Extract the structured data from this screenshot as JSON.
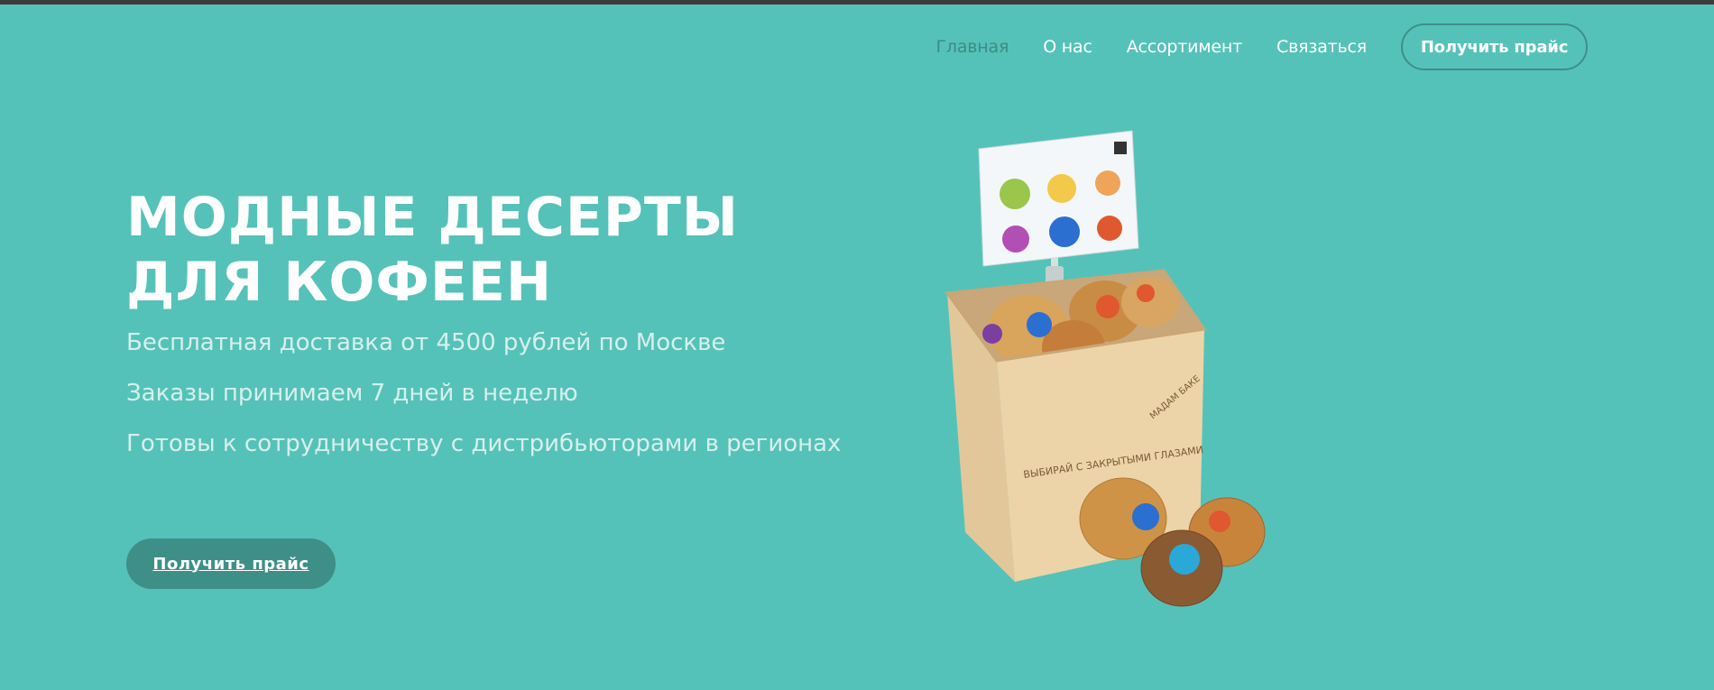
{
  "nav": {
    "items": [
      {
        "label": "Главная",
        "active": true
      },
      {
        "label": "О нас",
        "active": false
      },
      {
        "label": "Ассортимент",
        "active": false
      },
      {
        "label": "Связаться",
        "active": false
      }
    ],
    "cta_label": "Получить прайс"
  },
  "hero": {
    "title": "Модные десерты для кофеен",
    "lines": [
      "Бесплатная доставка от 4500 рублей по Москве",
      "Заказы принимаем 7 дней в неделю",
      "Готовы к сотрудничеству с дистрибьюторами в регионах"
    ],
    "cta_label": "Получить прайс"
  },
  "product": {
    "box_engraving": "ВЫБИРАЙ С ЗАКРЫТЫМИ ГЛАЗАМИ",
    "brand": "МАДАМ БАКЕ"
  },
  "colors": {
    "background": "#55c2b9",
    "accent": "#3e8f88",
    "nav_active": "#3e8b85",
    "subtitle": "#d7efec"
  }
}
